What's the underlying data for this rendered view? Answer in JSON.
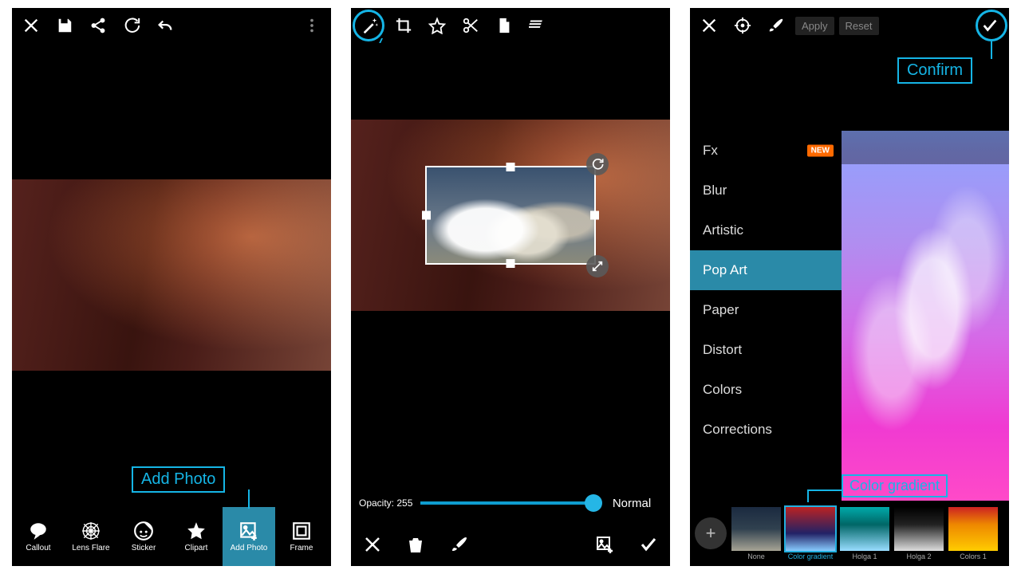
{
  "annotations": {
    "add_photo": "Add Photo",
    "confirm": "Confirm",
    "color_gradient": "Color gradient"
  },
  "screen1": {
    "tools": [
      {
        "label": "Callout"
      },
      {
        "label": "Lens Flare"
      },
      {
        "label": "Sticker"
      },
      {
        "label": "Clipart"
      },
      {
        "label": "Add Photo"
      },
      {
        "label": "Frame"
      }
    ],
    "selected_tool_index": 4
  },
  "screen2": {
    "opacity_label": "Opacity: 255",
    "blend_mode": "Normal"
  },
  "screen3": {
    "apply_label": "Apply",
    "reset_label": "Reset",
    "fx_groups": [
      {
        "label": "Fx",
        "badge": "NEW"
      },
      {
        "label": "Blur"
      },
      {
        "label": "Artistic"
      },
      {
        "label": "Pop Art",
        "selected": true
      },
      {
        "label": "Paper"
      },
      {
        "label": "Distort"
      },
      {
        "label": "Colors"
      },
      {
        "label": "Corrections"
      }
    ],
    "thumbs": [
      {
        "label": "None"
      },
      {
        "label": "Color gradient",
        "selected": true
      },
      {
        "label": "Holga 1"
      },
      {
        "label": "Holga 2"
      },
      {
        "label": "Colors 1"
      }
    ],
    "selected_fx_index": 3,
    "selected_thumb_index": 1
  }
}
